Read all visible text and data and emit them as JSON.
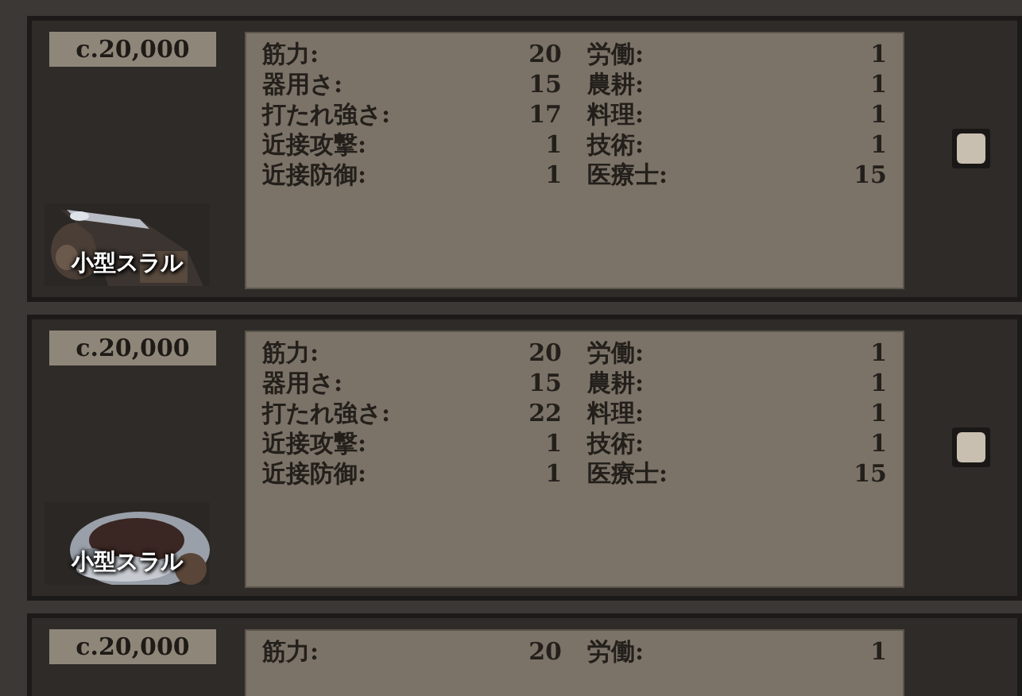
{
  "cards": [
    {
      "price": "c.20,000",
      "name": "小型スラル",
      "checked": false,
      "stats": [
        {
          "label_1": "筋力:",
          "value_1": "20",
          "label_2": "労働:",
          "value_2": "1"
        },
        {
          "label_1": "器用さ:",
          "value_1": "15",
          "label_2": "農耕:",
          "value_2": "1"
        },
        {
          "label_1": "打たれ強さ:",
          "value_1": "17",
          "label_2": "料理:",
          "value_2": "1"
        },
        {
          "label_1": "近接攻撃:",
          "value_1": "1",
          "label_2": "技術:",
          "value_2": "1"
        },
        {
          "label_1": "近接防御:",
          "value_1": "1",
          "label_2": "医療士:",
          "value_2": "15"
        }
      ]
    },
    {
      "price": "c.20,000",
      "name": "小型スラル",
      "checked": false,
      "stats": [
        {
          "label_1": "筋力:",
          "value_1": "20",
          "label_2": "労働:",
          "value_2": "1"
        },
        {
          "label_1": "器用さ:",
          "value_1": "15",
          "label_2": "農耕:",
          "value_2": "1"
        },
        {
          "label_1": "打たれ強さ:",
          "value_1": "22",
          "label_2": "料理:",
          "value_2": "1"
        },
        {
          "label_1": "近接攻撃:",
          "value_1": "1",
          "label_2": "技術:",
          "value_2": "1"
        },
        {
          "label_1": "近接防御:",
          "value_1": "1",
          "label_2": "医療士:",
          "value_2": "15"
        }
      ]
    },
    {
      "price": "c.20,000",
      "stats": [
        {
          "label_1": "筋力:",
          "value_1": "20",
          "label_2": "労働:",
          "value_2": "1"
        }
      ]
    }
  ]
}
